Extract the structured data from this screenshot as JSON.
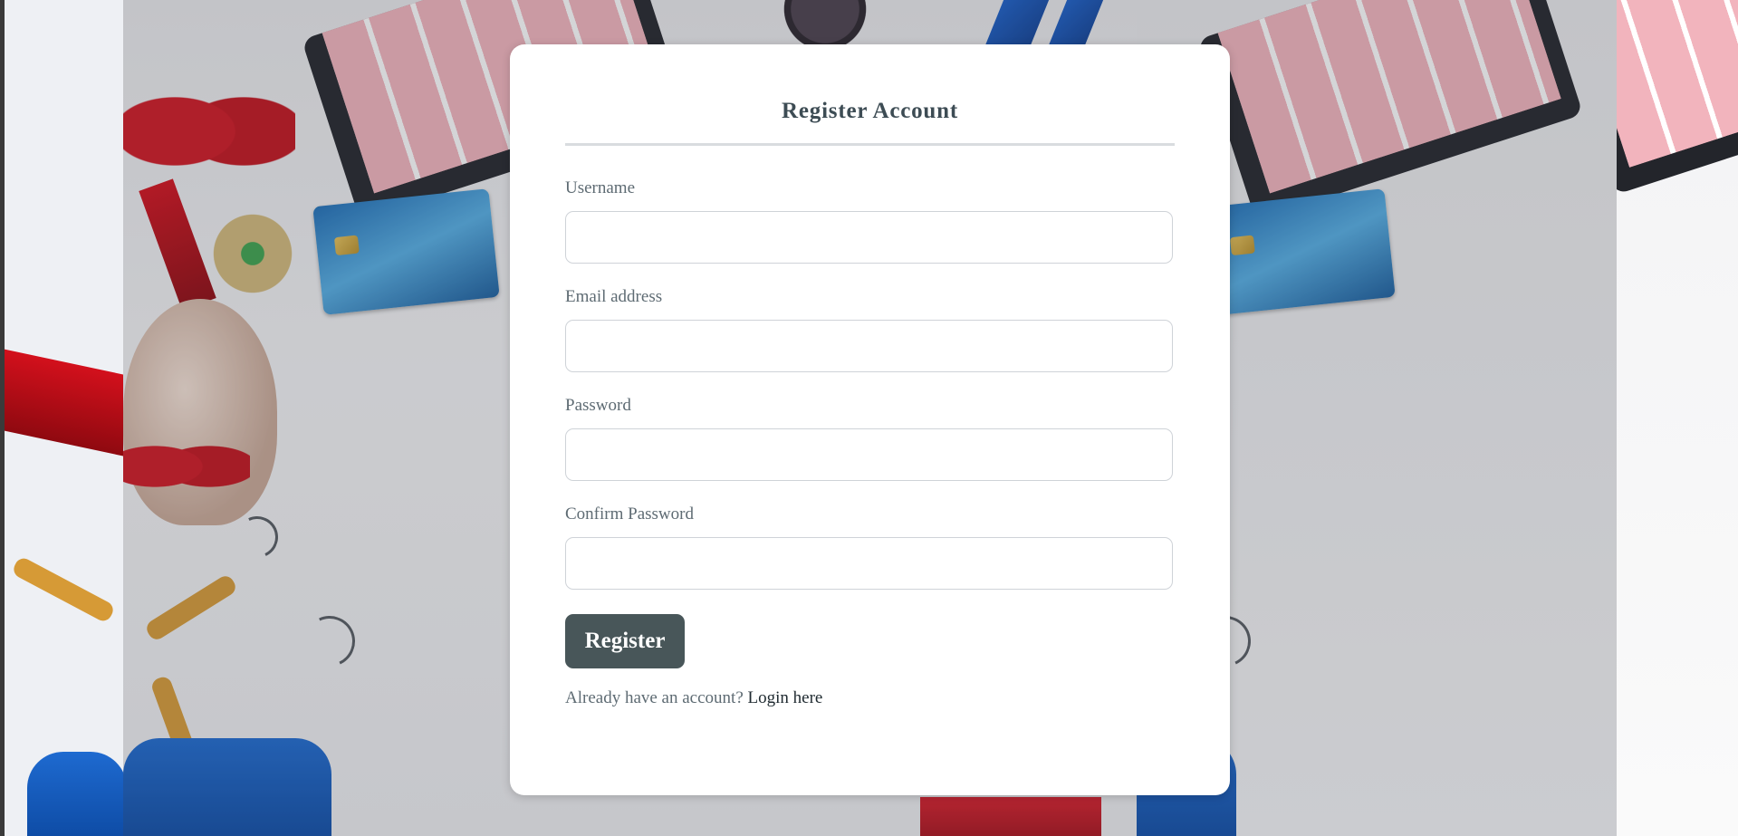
{
  "form": {
    "title": "Register Account",
    "fields": [
      {
        "label": "Username",
        "value": "",
        "placeholder": ""
      },
      {
        "label": "Email address",
        "value": "",
        "placeholder": ""
      },
      {
        "label": "Password",
        "value": "",
        "placeholder": ""
      },
      {
        "label": "Confirm Password",
        "value": "",
        "placeholder": ""
      }
    ],
    "submit_label": "Register",
    "login_prompt": "Already have an account?",
    "login_link": "Login here"
  },
  "colors": {
    "card_background": "#ffffff",
    "title_text": "#3d4c54",
    "button_background": "#485659",
    "button_text": "#ffffff",
    "label_text": "#5e6b73",
    "link_text": "#1f2a30"
  },
  "background": {
    "description_icons": [
      "gift-ribbon-icon",
      "tablet-shop-icon",
      "credit-card-icon",
      "hat-icon",
      "clothes-hanger-icon",
      "shirt-icon"
    ]
  }
}
